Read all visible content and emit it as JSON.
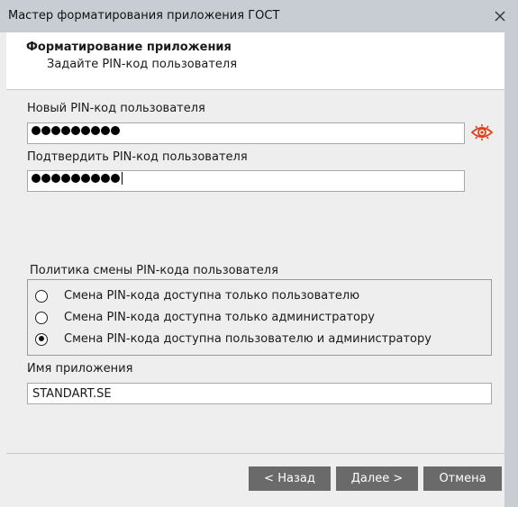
{
  "window": {
    "title": "Мастер форматирования приложения ГОСТ",
    "close_icon": "close-icon"
  },
  "header": {
    "title": "Форматирование приложения",
    "subtitle": "Задайте PIN-код пользователя"
  },
  "new_pin": {
    "label": "Новый PIN-код пользователя",
    "masked_length": 9,
    "show_icon": "eye-icon",
    "icon_color": "#e0401a"
  },
  "confirm_pin": {
    "label": "Подтвердить PIN-код пользователя",
    "masked_length": 9
  },
  "policy": {
    "label": "Политика смены PIN-кода пользователя",
    "options": [
      {
        "label": "Смена PIN-кода доступна только пользователю",
        "selected": false
      },
      {
        "label": "Смена PIN-кода доступна только администратору",
        "selected": false
      },
      {
        "label": "Смена PIN-кода доступна пользователю и администратору",
        "selected": true
      }
    ]
  },
  "app_name": {
    "label": "Имя приложения",
    "value": "STANDART.SE"
  },
  "buttons": {
    "back": "< Назад",
    "next": "Далее >",
    "cancel": "Отмена"
  }
}
